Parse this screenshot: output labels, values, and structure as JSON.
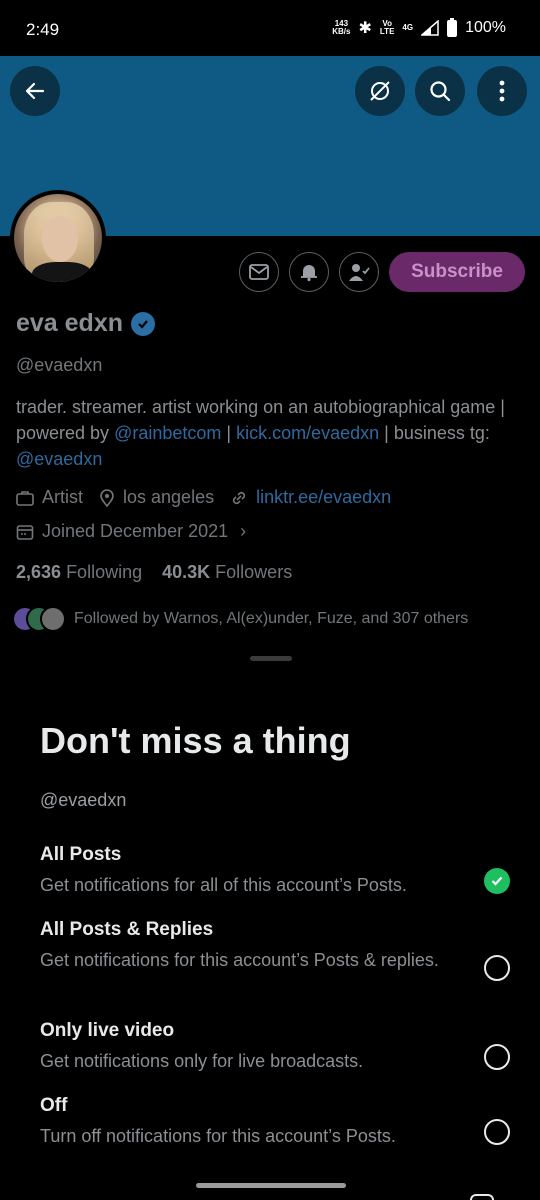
{
  "status_bar": {
    "time": "2:49",
    "net_speed": "143",
    "net_unit": "KB/s",
    "volte": "Vo",
    "lte": "LTE",
    "network": "4G",
    "battery": "100%"
  },
  "profile": {
    "subscribe_label": "Subscribe",
    "name": "eva edxn",
    "handle": "@evaedxn",
    "bio_text1": "trader. streamer. artist working on an autobiographical game | powered by ",
    "bio_link1": "@rainbetcom",
    "bio_sep1": " | ",
    "bio_link2": "kick.com/evaedxn",
    "bio_sep2": " | business tg: ",
    "bio_link3": "@evaedxn",
    "category": "Artist",
    "location": "los angeles",
    "website": "linktr.ee/evaedxn",
    "joined": "Joined December 2021",
    "following_count": "2,636",
    "following_label": "Following",
    "followers_count": "40.3K",
    "followers_label": "Followers",
    "followed_by": "Followed by Warnos, Al(ex)under, Fuze, and 307 others"
  },
  "sheet": {
    "title": "Don't miss a thing",
    "handle": "@evaedxn",
    "options": [
      {
        "title": "All Posts",
        "desc": "Get notifications for all of this account’s Posts.",
        "selected": true
      },
      {
        "title": "All Posts & Replies",
        "desc": "Get notifications for this account’s Posts & replies.",
        "selected": false
      },
      {
        "title": "Only live video",
        "desc": "Get notifications only for live broadcasts.",
        "selected": false
      },
      {
        "title": "Off",
        "desc": "Turn off notifications for this account’s Posts.",
        "selected": false
      }
    ]
  },
  "colors": {
    "banner": "#0f5a84",
    "subscribe_bg": "#6a2a6a",
    "check_green": "#1dbf60"
  }
}
